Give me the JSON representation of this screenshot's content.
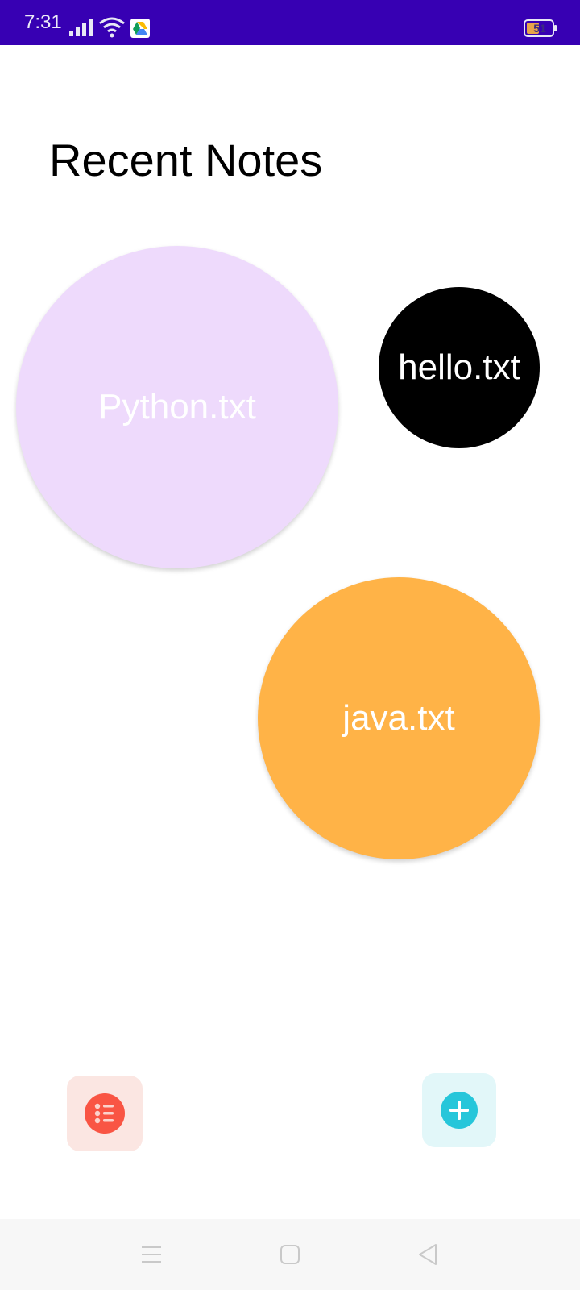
{
  "status_bar": {
    "time": "7:31",
    "battery": "51",
    "background_color": "#3700b3",
    "icons": [
      "signal-icon",
      "wifi-icon",
      "google-drive-icon",
      "battery-icon"
    ]
  },
  "page": {
    "title": "Recent Notes"
  },
  "notes": [
    {
      "label": "Python.txt",
      "color": "#eedafc",
      "text_color": "#ffffff"
    },
    {
      "label": "hello.txt",
      "color": "#000000",
      "text_color": "#ffffff"
    },
    {
      "label": "java.txt",
      "color": "#ffb347",
      "text_color": "#ffffff"
    }
  ],
  "actions": {
    "list_button": {
      "icon": "list-icon",
      "bg_color": "#fbe6e2",
      "icon_color": "#f95544"
    },
    "add_button": {
      "icon": "plus-icon",
      "bg_color": "#e2f7f9",
      "icon_color": "#26c6da"
    }
  },
  "nav_bar": {
    "icons": [
      "menu-icon",
      "home-square-icon",
      "back-triangle-icon"
    ]
  }
}
